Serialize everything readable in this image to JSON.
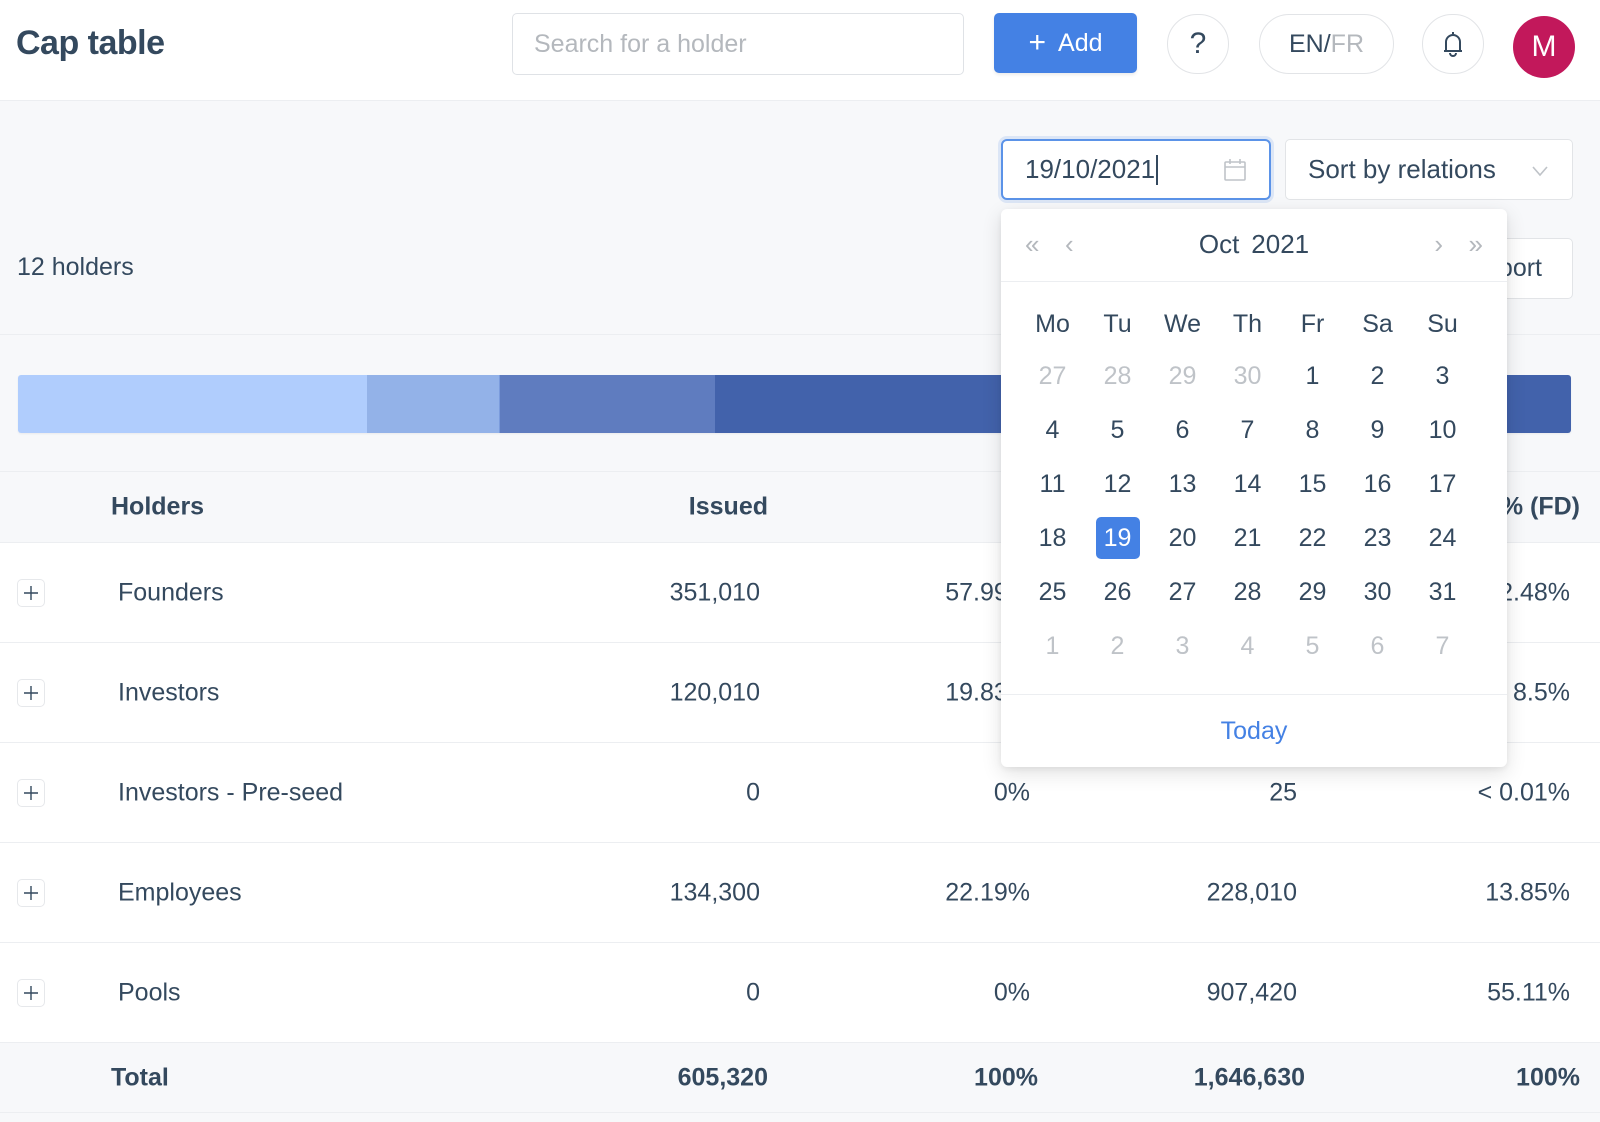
{
  "header": {
    "title": "Cap table",
    "search_placeholder": "Search for a holder",
    "add_label": "Add",
    "help_label": "?",
    "lang_en": "EN",
    "lang_sep": "/",
    "lang_fr": "FR",
    "avatar_initial": "M"
  },
  "colors": {
    "primary": "#4481e4",
    "avatar": "#c2185b",
    "text": "#34495e"
  },
  "toolbar": {
    "date_value": "19/10/2021",
    "sort_label": "Sort by relations",
    "holders_count": "12 holders",
    "export_label": "Export"
  },
  "distribution_bar": {
    "segments": [
      {
        "name": "Founders",
        "percent_fd": 22.48,
        "color": "#b0cdfd"
      },
      {
        "name": "Investors",
        "percent_fd": 8.5,
        "color": "#93b2e8"
      },
      {
        "name": "Investors - Pre-seed",
        "percent_fd": 0.01,
        "color": "#7a9bdc"
      },
      {
        "name": "Employees",
        "percent_fd": 13.85,
        "color": "#5f7cbf"
      },
      {
        "name": "Pools",
        "percent_fd": 55.11,
        "color": "#4262ab"
      }
    ]
  },
  "table": {
    "columns": {
      "holders": "Holders",
      "issued": "Issued",
      "percent": "%",
      "fully_diluted": "",
      "percent_fd": "% (FD)"
    },
    "rows": [
      {
        "name": "Founders",
        "issued": "351,010",
        "percent": "57.99%",
        "fully_diluted": "",
        "percent_fd": "22.48%"
      },
      {
        "name": "Investors",
        "issued": "120,010",
        "percent": "19.83%",
        "fully_diluted": "",
        "percent_fd": "8.5%"
      },
      {
        "name": "Investors - Pre-seed",
        "issued": "0",
        "percent": "0%",
        "fully_diluted": "25",
        "percent_fd": "< 0.01%"
      },
      {
        "name": "Employees",
        "issued": "134,300",
        "percent": "22.19%",
        "fully_diluted": "228,010",
        "percent_fd": "13.85%"
      },
      {
        "name": "Pools",
        "issued": "0",
        "percent": "0%",
        "fully_diluted": "907,420",
        "percent_fd": "55.11%"
      }
    ],
    "total": {
      "name": "Total",
      "issued": "605,320",
      "percent": "100%",
      "fully_diluted": "1,646,630",
      "percent_fd": "100%"
    }
  },
  "calendar": {
    "month": "Oct",
    "year": "2021",
    "nav": {
      "prev_year": "«",
      "prev_month": "‹",
      "next_month": "›",
      "next_year": "»"
    },
    "weekdays": [
      "Mo",
      "Tu",
      "We",
      "Th",
      "Fr",
      "Sa",
      "Su"
    ],
    "weeks": [
      [
        {
          "d": "27",
          "m": true
        },
        {
          "d": "28",
          "m": true
        },
        {
          "d": "29",
          "m": true
        },
        {
          "d": "30",
          "m": true
        },
        {
          "d": "1"
        },
        {
          "d": "2"
        },
        {
          "d": "3"
        }
      ],
      [
        {
          "d": "4"
        },
        {
          "d": "5"
        },
        {
          "d": "6"
        },
        {
          "d": "7"
        },
        {
          "d": "8"
        },
        {
          "d": "9"
        },
        {
          "d": "10"
        }
      ],
      [
        {
          "d": "11"
        },
        {
          "d": "12"
        },
        {
          "d": "13"
        },
        {
          "d": "14"
        },
        {
          "d": "15"
        },
        {
          "d": "16"
        },
        {
          "d": "17"
        }
      ],
      [
        {
          "d": "18"
        },
        {
          "d": "19",
          "s": true
        },
        {
          "d": "20"
        },
        {
          "d": "21"
        },
        {
          "d": "22"
        },
        {
          "d": "23"
        },
        {
          "d": "24"
        }
      ],
      [
        {
          "d": "25"
        },
        {
          "d": "26"
        },
        {
          "d": "27"
        },
        {
          "d": "28"
        },
        {
          "d": "29"
        },
        {
          "d": "30"
        },
        {
          "d": "31"
        }
      ],
      [
        {
          "d": "1",
          "m": true
        },
        {
          "d": "2",
          "m": true
        },
        {
          "d": "3",
          "m": true
        },
        {
          "d": "4",
          "m": true
        },
        {
          "d": "5",
          "m": true
        },
        {
          "d": "6",
          "m": true
        },
        {
          "d": "7",
          "m": true
        }
      ]
    ],
    "selected_day": "19",
    "today_label": "Today"
  }
}
